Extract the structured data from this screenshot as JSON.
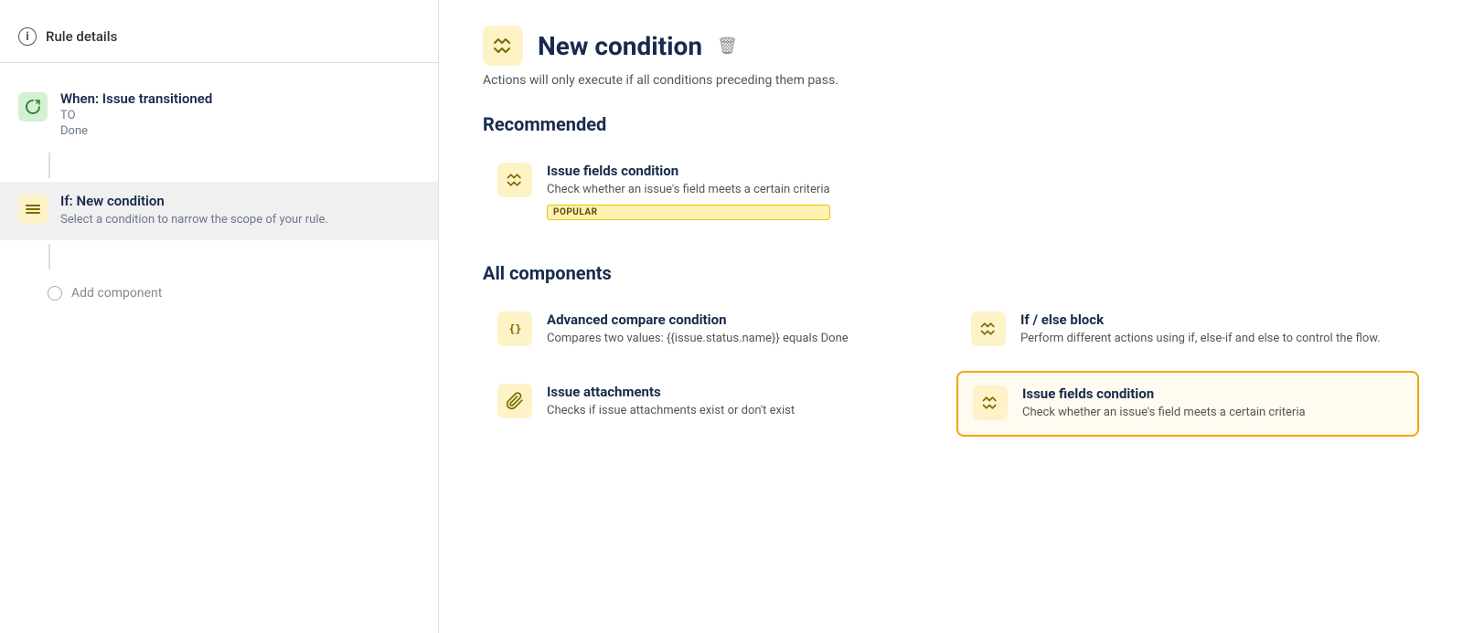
{
  "sidebar": {
    "ruleDetails": {
      "icon": "ℹ",
      "label": "Rule details"
    },
    "items": [
      {
        "id": "when-issue-transitioned",
        "iconType": "green",
        "iconSymbol": "↺",
        "title": "When: Issue transitioned",
        "sub1": "TO",
        "sub2": "Done",
        "active": false
      },
      {
        "id": "if-new-condition",
        "iconType": "yellow",
        "iconSymbol": "≡",
        "title": "If: New condition",
        "description": "Select a condition to narrow the scope of your rule.",
        "active": true
      }
    ],
    "addComponent": "Add component"
  },
  "main": {
    "header": {
      "iconSymbol": "⇌",
      "title": "New condition",
      "trashIcon": "🗑"
    },
    "subtitle": "Actions will only execute if all conditions preceding them pass.",
    "recommended": {
      "sectionTitle": "Recommended",
      "cards": [
        {
          "id": "issue-fields-condition-recommended",
          "iconSymbol": "⇌",
          "title": "Issue fields condition",
          "description": "Check whether an issue's field meets a certain criteria",
          "badge": "POPULAR"
        }
      ]
    },
    "allComponents": {
      "sectionTitle": "All components",
      "cards": [
        {
          "id": "advanced-compare-condition",
          "iconSymbol": "{}",
          "title": "Advanced compare condition",
          "description": "Compares two values: {{issue.status.name}} equals Done",
          "highlighted": false
        },
        {
          "id": "if-else-block",
          "iconSymbol": "⇌",
          "title": "If / else block",
          "description": "Perform different actions using if, else-if and else to control the flow.",
          "highlighted": false
        },
        {
          "id": "issue-attachments",
          "iconSymbol": "📎",
          "title": "Issue attachments",
          "description": "Checks if issue attachments exist or don't exist",
          "highlighted": false
        },
        {
          "id": "issue-fields-condition-all",
          "iconSymbol": "⇌",
          "title": "Issue fields condition",
          "description": "Check whether an issue's field meets a certain criteria",
          "highlighted": true
        }
      ]
    }
  }
}
